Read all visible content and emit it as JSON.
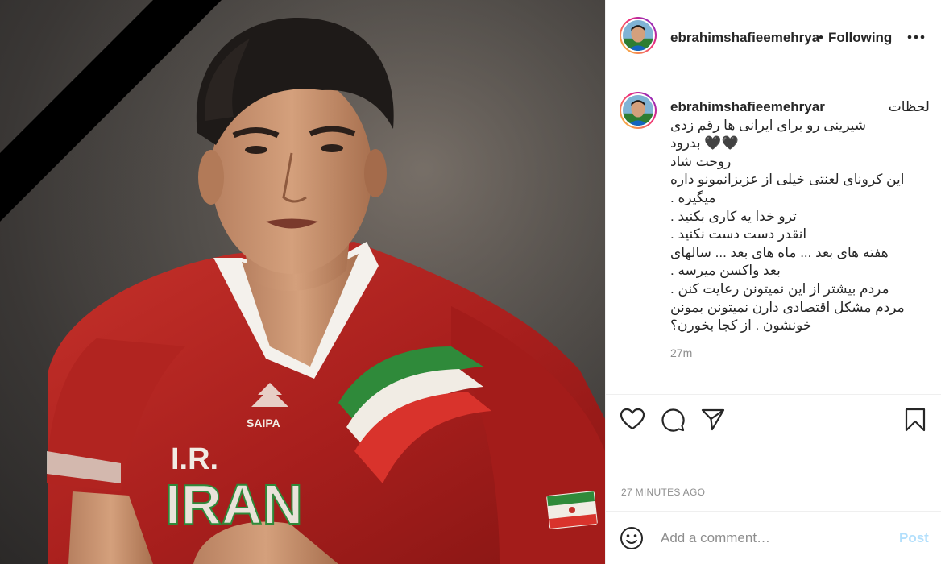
{
  "header": {
    "username": "ebrahimshafieemehrya",
    "separator": "•",
    "follow_status": "Following"
  },
  "caption": {
    "username": "ebrahimshafieemehryar",
    "first_line": "لحظات",
    "lines": [
      "شیرینی رو برای ایرانی ها رقم زدی",
      "🖤🖤 بدرود",
      "روحت شاد",
      "این کرونای لعنتی خیلی از عزیزانمونو داره",
      "میگیره .",
      "ترو خدا یه کاری بکنید .",
      "انقدر دست دست نکنید .",
      "هفته های بعد ... ماه های بعد ... سالهای",
      "بعد واکسن میرسه .",
      "مردم بیشتر از این نمیتونن رعایت کنن .",
      "مردم مشکل اقتصادی دارن نمیتونن بمونن",
      "خونشون . از کجا بخورن؟"
    ],
    "relative_time": "27m"
  },
  "actions": {
    "like_icon": "heart-icon",
    "comment_icon": "comment-icon",
    "share_icon": "share-icon",
    "save_icon": "bookmark-icon"
  },
  "timestamp": "27 MINUTES AGO",
  "comment_box": {
    "placeholder": "Add a comment…",
    "post_label": "Post"
  },
  "media": {
    "description_icon": "mourning-ribbon",
    "shirt_text_top": "I.R.",
    "shirt_text_bottom": "IRAN",
    "sponsor": "SAIPA"
  },
  "colors": {
    "post_button": "#b2dffc",
    "muted_text": "#8e8e8e",
    "jersey_red": "#b3201f",
    "story_ring_start": "#f9ce34",
    "story_ring_end": "#6228d7"
  }
}
